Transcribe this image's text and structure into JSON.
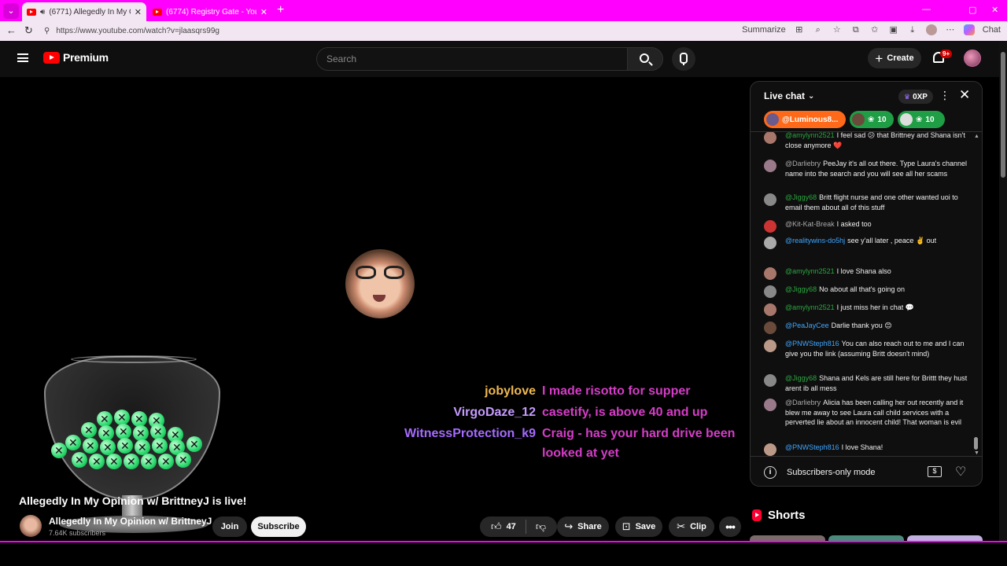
{
  "browser": {
    "tabs": [
      {
        "title": "(6771) Allegedly In My Opinion",
        "active": true
      },
      {
        "title": "(6774) Registry Gate - YouTube",
        "active": false
      }
    ],
    "url": "https://www.youtube.com/watch?v=jlaasqrs99g",
    "summarize_label": "Summarize",
    "chat_label": "Chat"
  },
  "youtube": {
    "logo_text": "Premium",
    "search_placeholder": "Search",
    "create_label": "Create",
    "notification_badge": "9+"
  },
  "overlay_chat": [
    {
      "name": "jobylove",
      "name_color": "#f0b84f",
      "message": "I made risotto for supper"
    },
    {
      "name": "VirgoDaze_12",
      "name_color": "#c59bff",
      "message": "casetify, is above 40 and up"
    },
    {
      "name": "WitnessProtection_k9",
      "name_color": "#a66bff",
      "message": "Craig - has your hard drive been",
      "message_cont": "looked at yet"
    }
  ],
  "video": {
    "title": "Allegedly In My Opinion w/ BrittneyJ is live!",
    "channel_name": "Allegedly In My Opinion w/ BrittneyJ",
    "subscribers": "7.64K subscribers",
    "join_label": "Join",
    "subscribe_label": "Subscribe",
    "like_count": "47",
    "share_label": "Share",
    "save_label": "Save",
    "clip_label": "Clip"
  },
  "live_chat": {
    "title": "Live chat",
    "xp_label": "0XP",
    "pinned": [
      {
        "label": "@Luminous8..."
      },
      {
        "label": "10"
      },
      {
        "label": "10"
      }
    ],
    "messages": [
      {
        "author": "@amylynn2521",
        "text": "I feel sad 😕 that Brittney and Shana isn't close anymore ❤️"
      },
      {
        "author": "@Darliebry",
        "text": "PeeJay it's all out there. Type Laura's channel name into the search and you will see all her scams"
      },
      {
        "author": "@Jiggy68",
        "text": "Britt flight nurse and one other wanted uoi to email them about all of this stuff"
      },
      {
        "author": "@Kit-Kat-Break",
        "text": "I asked too"
      },
      {
        "author": "@realitywins-do5hj",
        "text": "see y'all later , peace ✌️ out"
      },
      {
        "author": "@amylynn2521",
        "text": "I love Shana also"
      },
      {
        "author": "@Jiggy68",
        "text": "No about all that's going on"
      },
      {
        "author": "@amylynn2521",
        "text": "I just miss her in chat 💬"
      },
      {
        "author": "@PeaJayCee",
        "text": "Darlie thank you 😊"
      },
      {
        "author": "@PNWSteph816",
        "text": "You can also reach out to me and I can give you the link (assuming Britt doesn't mind)"
      },
      {
        "author": "@Jiggy68",
        "text": "Shana and Kels are still here for Brittt they hust arent ib all mess"
      },
      {
        "author": "@Darliebry",
        "text": "Alicia has been calling her out recently and it blew me away to see Laura call child services with a perverted lie about an innocent child! That woman is evil"
      },
      {
        "author": "@PNWSteph816",
        "text": "I love Shana!"
      }
    ],
    "footer_text": "Subscribers-only mode"
  },
  "shorts": {
    "title": "Shorts"
  },
  "colors": {
    "tab_strip": "#ff00ff",
    "yt_red": "#ff0000",
    "overlay_message": "#d63cc8"
  }
}
